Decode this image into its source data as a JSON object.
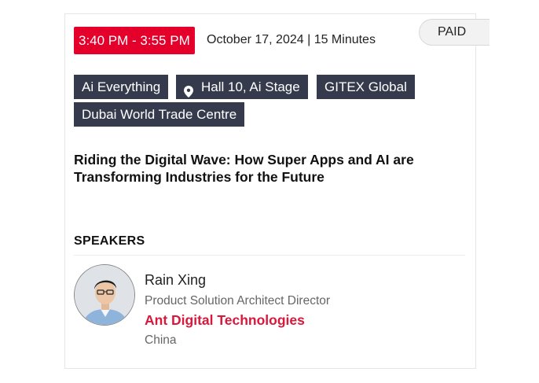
{
  "session": {
    "time": "3:40 PM - 3:55 PM",
    "date_duration": "October 17, 2024 | 15 Minutes",
    "price_badge": "PAID",
    "title": "Riding the Digital Wave: How Super Apps and AI are Transforming Industries for the Future"
  },
  "tags": [
    {
      "label": "Ai Everything",
      "icon": null
    },
    {
      "label": "Hall 10, Ai Stage",
      "icon": "location-pin-icon"
    },
    {
      "label": "GITEX Global",
      "icon": null
    },
    {
      "label": "Dubai World Trade Centre",
      "icon": null
    }
  ],
  "speakers_section": {
    "heading": "SPEAKERS",
    "speakers": [
      {
        "name": "Rain Xing",
        "role": "Product Solution Architect Director",
        "company": "Ant Digital Technologies",
        "country": "China"
      }
    ]
  },
  "colors": {
    "accent_red": "#e4002b",
    "company_red": "#d9183b",
    "tag_bg": "#353b4c"
  }
}
